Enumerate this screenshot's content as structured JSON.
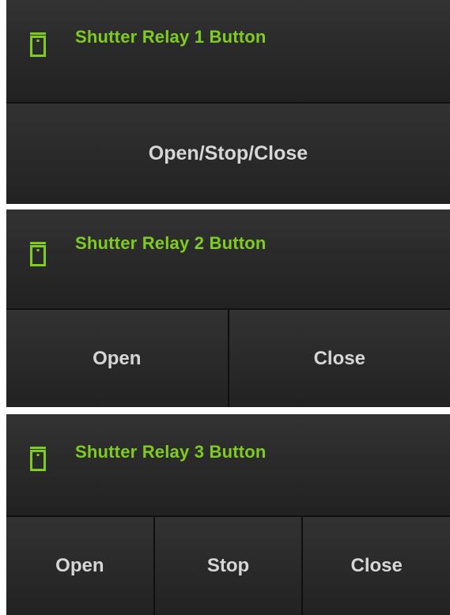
{
  "colors": {
    "accent": "#7fcc1e",
    "panel": "#2a2a2a",
    "button_text": "#d6d6d6",
    "background": "#ffffff"
  },
  "cards": [
    {
      "icon": "shutter-icon",
      "title": "Shutter Relay 1 Button",
      "buttons": [
        "Open/Stop/Close"
      ]
    },
    {
      "icon": "shutter-icon",
      "title": "Shutter Relay 2 Button",
      "buttons": [
        "Open",
        "Close"
      ]
    },
    {
      "icon": "shutter-icon",
      "title": "Shutter Relay 3 Button",
      "buttons": [
        "Open",
        "Stop",
        "Close"
      ]
    }
  ]
}
